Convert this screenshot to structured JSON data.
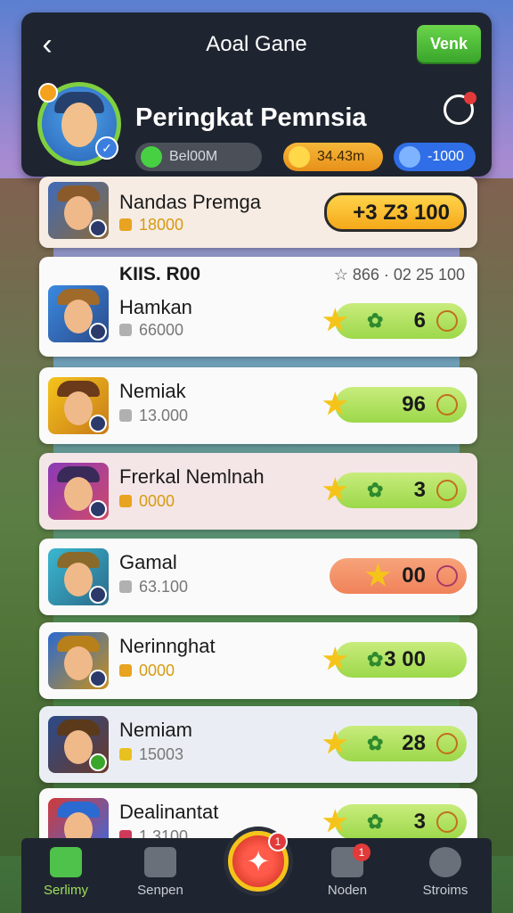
{
  "header": {
    "title": "Aoal Gane",
    "back_label": "‹",
    "menu_label": "Venk",
    "player_name": "Peringkat Pemnsia",
    "stats": [
      {
        "label": "Bel00M",
        "icon": "coin-green-icon"
      },
      {
        "label": "34.43m",
        "icon": "coin-gold-icon"
      },
      {
        "label": "-1000",
        "icon": "star-blue-icon"
      }
    ]
  },
  "rows": [
    {
      "name": "Nandas Premga",
      "sub": "18000",
      "score": "+3 Z3 100",
      "style": "gold-pill"
    },
    {
      "extra": "KIIS. R00",
      "extra_right": "☆ 866 · 02 25 100",
      "name": "Hamkan",
      "sub": "66000",
      "score": "6"
    },
    {
      "name": "Nemiak",
      "sub": "13.000",
      "score": "96"
    },
    {
      "name": "Frerkal Nemlnah",
      "sub": "0000",
      "score": "3"
    },
    {
      "name": "Gamal",
      "sub": "63.100",
      "score": "00",
      "style": "orange"
    },
    {
      "name": "Nerinnghat",
      "sub": "0000",
      "score": "3 00"
    },
    {
      "name": "Nemiam",
      "sub": "15003",
      "score": "28"
    },
    {
      "name": "Dealinantat",
      "sub": "1.3100",
      "score": "3"
    }
  ],
  "tabs": [
    {
      "label": "Serlimy",
      "active": true
    },
    {
      "label": "Senpen",
      "active": false
    },
    {
      "label": "Noden",
      "active": false,
      "badge": "1"
    },
    {
      "label": "Stroims",
      "active": false
    }
  ],
  "center_badge": "1",
  "colors": {
    "accent_green": "#4ec24a",
    "gold": "#f5c41b",
    "header_bg": "#1f2530"
  }
}
